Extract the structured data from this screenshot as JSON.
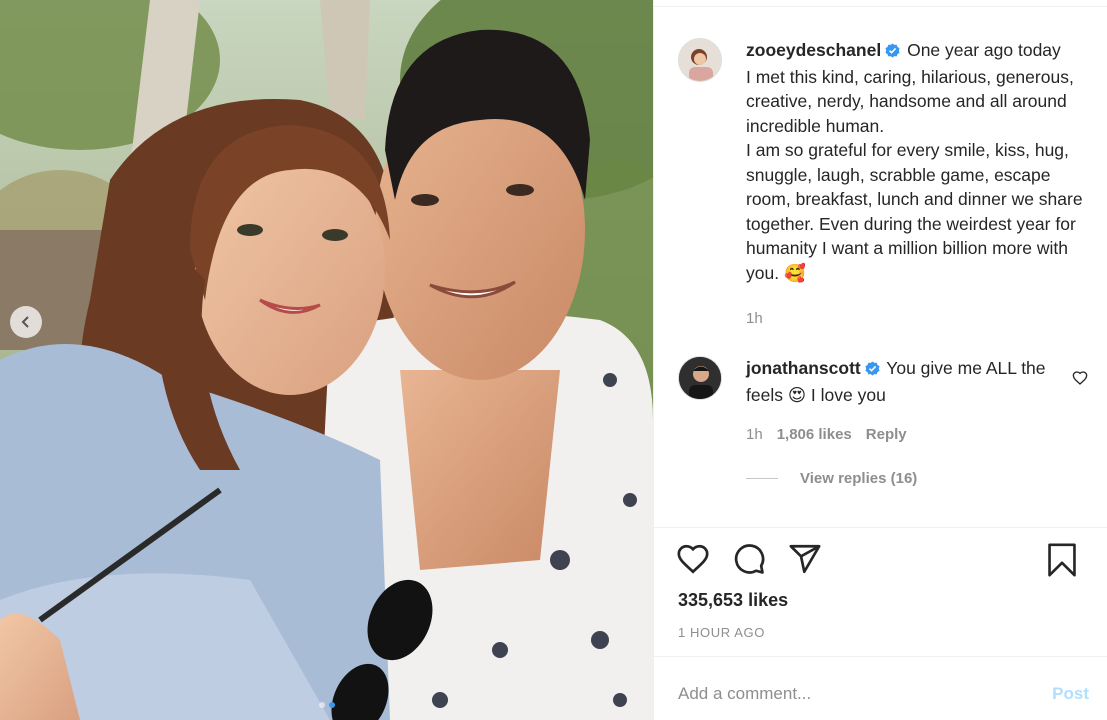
{
  "post": {
    "author": "zooeydeschanel",
    "caption": "One year ago today\nI met this kind, caring, hilarious, generous, creative, nerdy, handsome and all around incredible human.\nI am so grateful for every smile, kiss, hug, snuggle, laugh, scrabble game, escape room, breakfast, lunch and dinner we share together. Even during the weirdest year for humanity I want a million billion more with you. 🥰",
    "caption_time": "1h",
    "likes": "335,653 likes",
    "posted": "1 HOUR AGO"
  },
  "comment": {
    "author": "jonathanscott",
    "text": "You give me ALL the feels 😍 I love you",
    "time": "1h",
    "likes": "1,806 likes",
    "reply_label": "Reply",
    "view_replies": "View replies (16)"
  },
  "composer": {
    "placeholder": "Add a comment...",
    "post_label": "Post"
  },
  "icons": {
    "verified": "verified-badge-icon",
    "like": "heart-icon",
    "comment": "comment-icon",
    "share": "share-icon",
    "save": "bookmark-icon",
    "carousel_prev": "chevron-left-icon"
  },
  "colors": {
    "verified": "#3897f0",
    "post_button_disabled": "#b2dffc",
    "muted_text": "#8e8e8e"
  }
}
